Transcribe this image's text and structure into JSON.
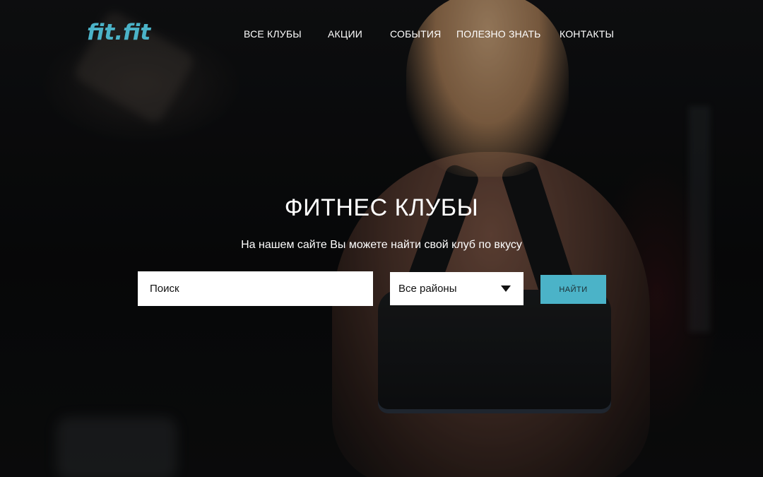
{
  "brand": {
    "logo_text": "fit.fit",
    "accent_color": "#4bb3c8"
  },
  "nav": {
    "items": [
      {
        "label": "ВСЕ КЛУБЫ"
      },
      {
        "label": "АКЦИИ"
      },
      {
        "label": "СОБЫТИЯ"
      },
      {
        "label": "ПОЛЕЗНО ЗНАТЬ"
      },
      {
        "label": "КОНТАКТЫ"
      }
    ]
  },
  "hero": {
    "title": "ФИТНЕС КЛУБЫ",
    "subtitle": "На нашем сайте Вы можете найти свой клуб по вкусу",
    "background": "fitness-woman-back-photo"
  },
  "search": {
    "placeholder": "Поиск",
    "value": "",
    "district_selected": "Все районы",
    "district_icon": "caret-down-icon",
    "button_label": "НАЙТИ"
  }
}
